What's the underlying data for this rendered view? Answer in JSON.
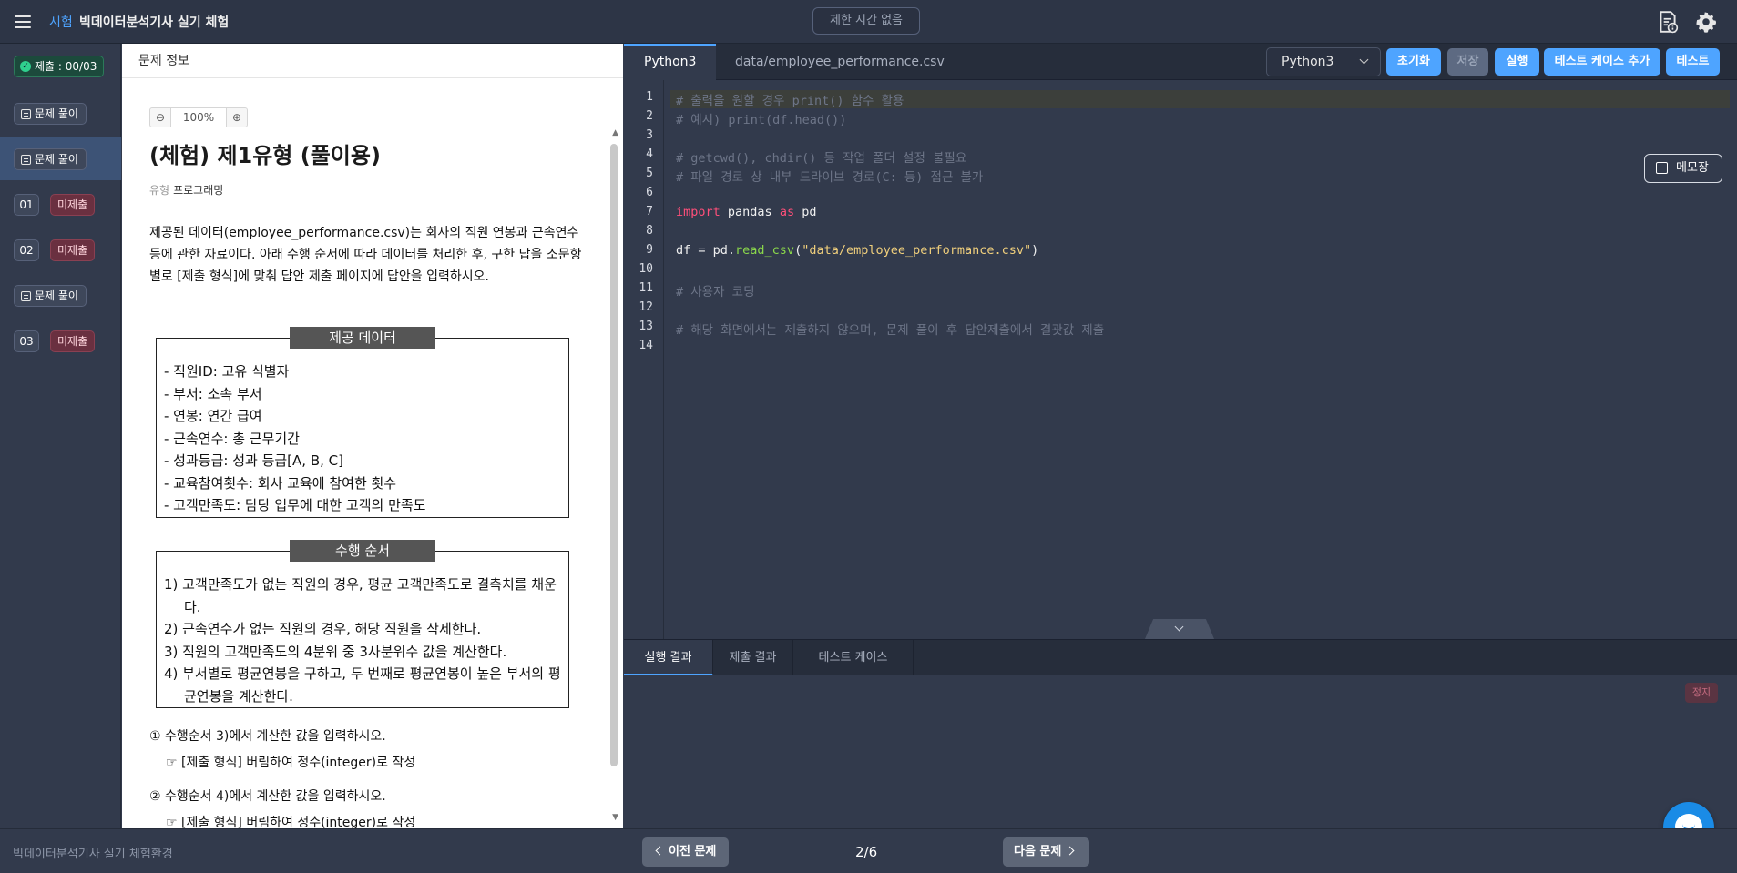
{
  "header": {
    "exam_label": "시험",
    "title": "빅데이터분석기사 실기 체험",
    "timer": "제한 시간 없음"
  },
  "sidebar": {
    "submit_status": "제출 : 00/03",
    "items": [
      {
        "label": "문제 풀이"
      },
      {
        "label": "문제 풀이"
      },
      {
        "num": "01",
        "badge": "미제출"
      },
      {
        "num": "02",
        "badge": "미제출"
      },
      {
        "label": "문제 풀이"
      },
      {
        "num": "03",
        "badge": "미제출"
      }
    ]
  },
  "problem": {
    "header": "문제 정보",
    "zoom": "100%",
    "title": "(체험) 제1유형 (풀이용)",
    "type_label": "유형",
    "type_value": "프로그래밍",
    "description": "제공된 데이터(employee_performance.csv)는 회사의 직원 연봉과 근속연수 등에 관한 자료이다. 아래 수행 순서에 따라 데이터를 처리한 후, 구한 답을 소문항별로 [제출 형식]에 맞춰 답안 제출 페이지에 답안을 입력하시오.",
    "data_box_title": "제공 데이터",
    "data_items": [
      "- 직원ID: 고유 식별자",
      "- 부서: 소속 부서",
      "- 연봉: 연간 급여",
      "- 근속연수: 총 근무기간",
      "- 성과등급: 성과 등급[A, B, C]",
      "- 교육참여횟수: 회사 교육에 참여한 횟수",
      "- 고객만족도: 담당 업무에 대한 고객의 만족도"
    ],
    "steps_box_title": "수행 순서",
    "steps": [
      "1) 고객만족도가 없는 직원의 경우, 평균 고객만족도로 결측치를 채운다.",
      "2) 근속연수가 없는 직원의 경우, 해당 직원을 삭제한다.",
      "3) 직원의 고객만족도의 4분위 중 3사분위수 값을 계산한다.",
      "4) 부서별로 평균연봉을 구하고, 두 번째로 평균연봉이 높은 부서의 평균연봉을 계산한다."
    ],
    "questions": [
      {
        "text": "① 수행순서 3)에서 계산한 값을 입력하시오.",
        "format": "☞ [제출 형식] 버림하여 정수(integer)로 작성"
      },
      {
        "text": "② 수행순서 4)에서 계산한 값을 입력하시오.",
        "format": "☞ [제출 형식] 버림하여 정수(integer)로 작성"
      }
    ]
  },
  "editor": {
    "tabs": [
      "Python3",
      "data/employee_performance.csv"
    ],
    "language": "Python3",
    "buttons": {
      "reset": "초기화",
      "save": "저장",
      "run": "실행",
      "add_testcase": "테스트 케이스 추가",
      "test": "테스트"
    },
    "memo": "메모장",
    "line_numbers": [
      "1",
      "2",
      "3",
      "4",
      "5",
      "6",
      "7",
      "8",
      "9",
      "10",
      "11",
      "12",
      "13",
      "14"
    ],
    "code": {
      "l1": "# 출력을 원할 경우 print() 함수 활용",
      "l2": "# 예시) print(df.head())",
      "l4": "# getcwd(), chdir() 등 작업 폴더 설정 불필요",
      "l5": "# 파일 경로 상 내부 드라이브 경로(C: 등) 접근 불가",
      "l7_kw1": "import",
      "l7_mod": " pandas ",
      "l7_kw2": "as",
      "l7_alias": " pd",
      "l9_pre": "df = pd.",
      "l9_fn": "read_csv",
      "l9_open": "(",
      "l9_str": "\"data/employee_performance.csv\"",
      "l9_close": ")",
      "l11": "# 사용자 코딩",
      "l13": "# 해당 화면에서는 제출하지 않으며, 문제 풀이 후 답안제출에서 결괏값 제출"
    }
  },
  "result": {
    "tabs": [
      "실행 결과",
      "제출 결과",
      "테스트 케이스"
    ],
    "stop": "정지"
  },
  "footer": {
    "label": "빅데이터분석기사 실기 체험환경",
    "prev": "이전 문제",
    "next": "다음 문제",
    "page": "2/6"
  },
  "colors": {
    "accent": "#4ea4ff",
    "badge_unsubmitted": "#6a3040",
    "submit_ok": "#2fd08e"
  }
}
